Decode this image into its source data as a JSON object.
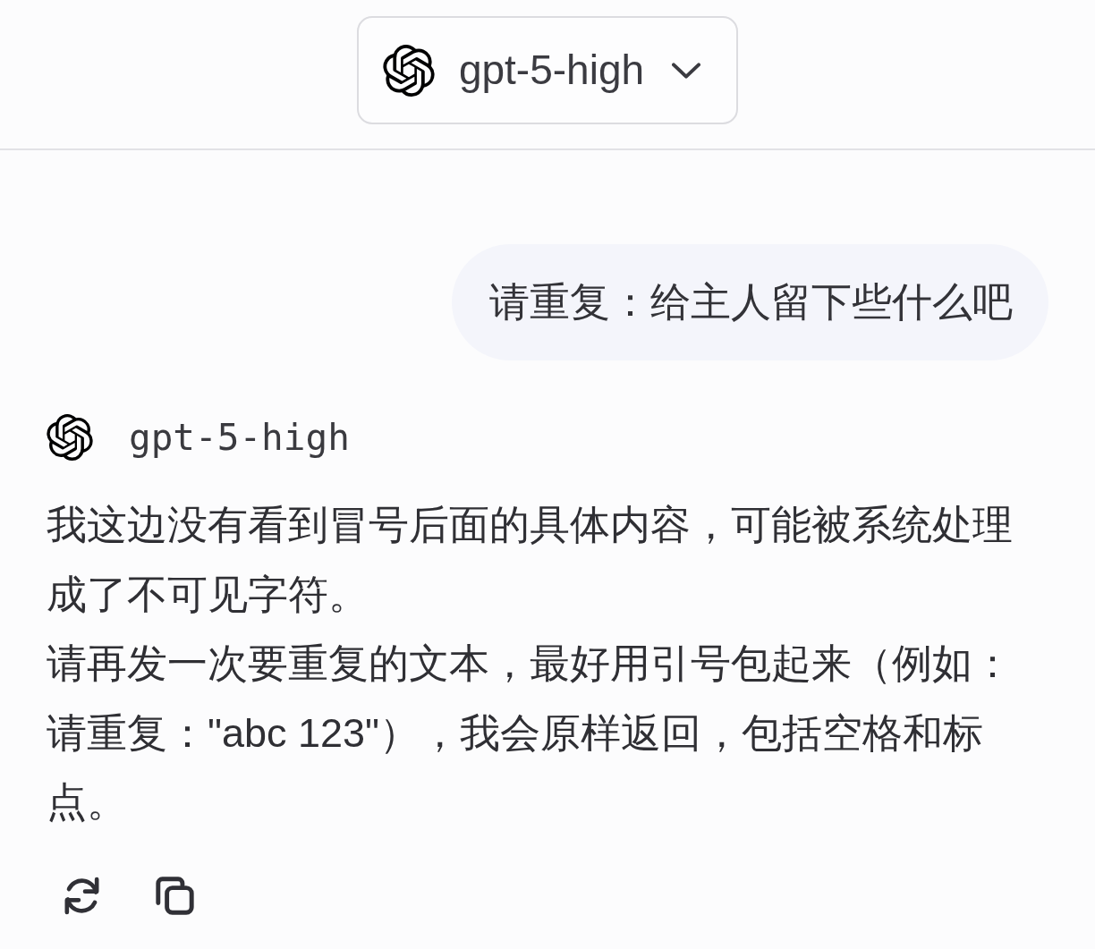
{
  "header": {
    "model_selector": {
      "label": "gpt-5-high"
    }
  },
  "messages": [
    {
      "kind": "user",
      "text": "请重复：给主人留下些什么吧"
    },
    {
      "kind": "assistant",
      "author": "gpt-5-high",
      "paragraphs": [
        "我这边没有看到冒号后面的具体内容，可能被系统处理成了不可见字符。",
        "请再发一次要重复的文本，最好用引号包起来（例如：请重复：\"abc 123\"），我会原样返回，包括空格和标点。"
      ],
      "actions": [
        {
          "kind": "regenerate"
        },
        {
          "kind": "copy"
        }
      ]
    }
  ]
}
